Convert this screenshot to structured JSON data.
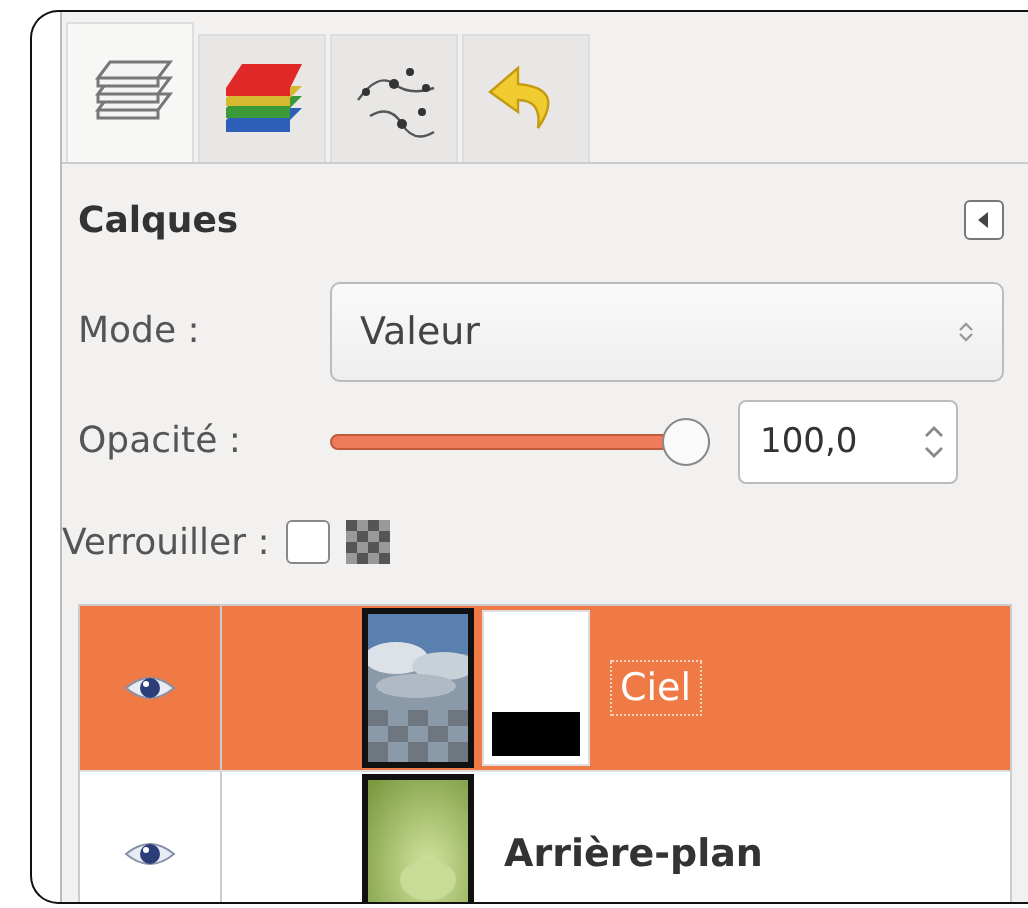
{
  "tabs": [
    {
      "kind": "layers",
      "selected": true
    },
    {
      "kind": "channels",
      "selected": false
    },
    {
      "kind": "paths",
      "selected": false
    },
    {
      "kind": "undo",
      "selected": false
    }
  ],
  "dockable": {
    "title": "Calques"
  },
  "mode": {
    "label": "Mode :",
    "value": "Valeur"
  },
  "opacity": {
    "label": "Opacité :",
    "level": 1,
    "value": "100,0"
  },
  "lock": {
    "label": "Verrouiller :",
    "pixels_checked": false
  },
  "layers": [
    {
      "name": "Ciel",
      "visible": true,
      "selected": true,
      "has_alpha": true,
      "has_mask": true
    },
    {
      "name": "Arrière-plan",
      "visible": true,
      "selected": false,
      "has_alpha": false,
      "has_mask": false
    }
  ]
}
